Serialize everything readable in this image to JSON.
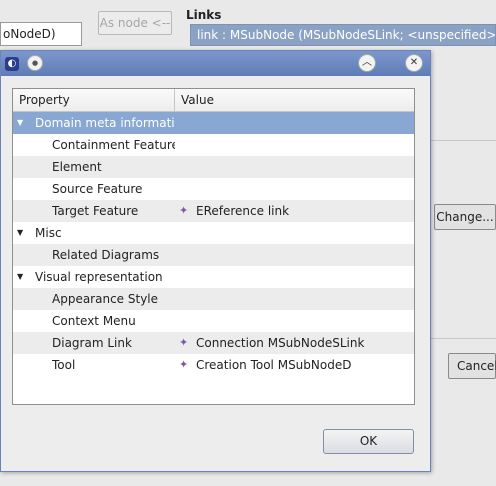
{
  "background": {
    "left_field": "oNodeD)",
    "as_node_button": "As node <--",
    "links_label": "Links",
    "links_item": "link : MSubNode (MSubNodeSLink; <unspecified>)",
    "change_button": "Change...",
    "cancel_button": "Cancel"
  },
  "dialog": {
    "icons": {
      "app": "eclipse-icon",
      "pin": "pin-icon",
      "minimize": "minimize-icon",
      "close": "close-icon"
    },
    "columns": {
      "property": "Property",
      "value": "Value"
    },
    "rows": [
      {
        "level": 0,
        "expanded": true,
        "label": "Domain meta informatior",
        "value": "",
        "selected": true
      },
      {
        "level": 1,
        "label": "Containment Feature",
        "value": ""
      },
      {
        "level": 1,
        "label": "Element",
        "value": ""
      },
      {
        "level": 1,
        "label": "Source Feature",
        "value": ""
      },
      {
        "level": 1,
        "label": "Target Feature",
        "value": "EReference link",
        "value_icon": "ereference-icon"
      },
      {
        "level": 0,
        "expanded": true,
        "label": "Misc",
        "value": ""
      },
      {
        "level": 1,
        "label": "Related Diagrams",
        "value": ""
      },
      {
        "level": 0,
        "expanded": true,
        "label": "Visual representation",
        "value": ""
      },
      {
        "level": 1,
        "label": "Appearance Style",
        "value": ""
      },
      {
        "level": 1,
        "label": "Context Menu",
        "value": ""
      },
      {
        "level": 1,
        "label": "Diagram Link",
        "value": "Connection MSubNodeSLink",
        "value_icon": "connection-icon"
      },
      {
        "level": 1,
        "label": "Tool",
        "value": "Creation Tool MSubNodeD",
        "value_icon": "tool-icon"
      }
    ],
    "ok_button": "OK"
  },
  "colors": {
    "selection": "#88a7d3",
    "titlebar": "#6d88c1",
    "value_icon": "#7a5aa5"
  }
}
